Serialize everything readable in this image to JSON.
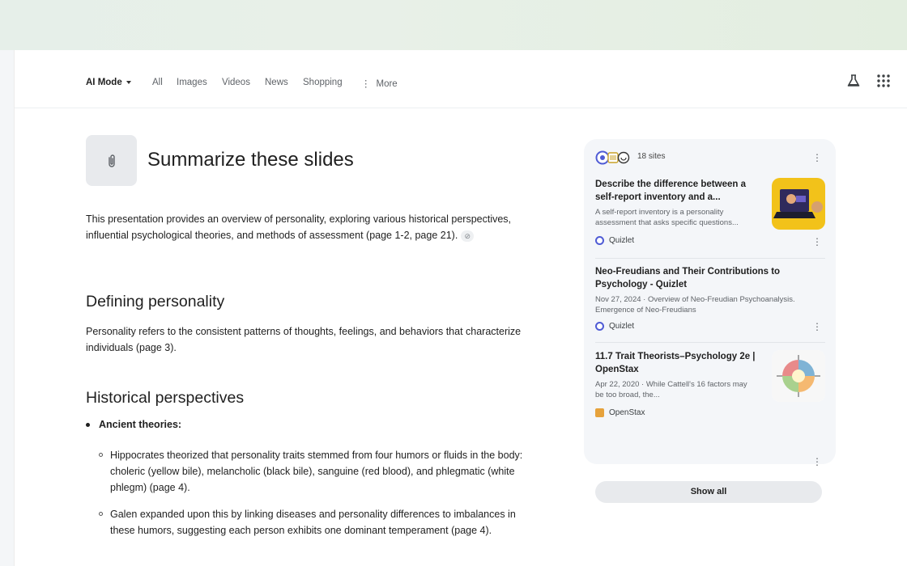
{
  "nav": {
    "ai_mode": "AI Mode",
    "tabs": [
      "All",
      "Images",
      "Videos",
      "News",
      "Shopping"
    ],
    "more": "More"
  },
  "query": {
    "title": "Summarize these slides",
    "attachment_icon": "paperclip-icon"
  },
  "answer": {
    "intro": "This presentation provides an overview of personality, exploring various historical perspectives, influential psychological theories, and methods of assessment (page 1-2, page 21).",
    "section1_heading": "Defining personality",
    "section1_text": "Personality refers to the consistent patterns of thoughts, feelings, and behaviors that characterize individuals (page 3).",
    "section2_heading": "Historical perspectives",
    "bullet_label": "Ancient theories:",
    "sub_bullets": [
      "Hippocrates theorized that personality traits stemmed from four humors or fluids in the body: choleric (yellow bile), melancholic (black bile), sanguine (red blood), and phlegmatic (white phlegm) (page 4).",
      "Galen expanded upon this by linking diseases and personality differences to imbalances in these humors, suggesting each person exhibits one dominant temperament (page 4)."
    ]
  },
  "sources": {
    "count_label": "18 sites",
    "items": [
      {
        "title": "Describe the difference between a self-report inventory and a...",
        "snippet": "A self-report inventory is a personality assessment that asks specific questions...",
        "site": "Quizlet",
        "favicon_color": "#4f5bd5"
      },
      {
        "title": "Neo-Freudians and Their Contributions to Psychology - Quizlet",
        "snippet": "Nov 27, 2024 · Overview of Neo-Freudian Psychoanalysis. Emergence of Neo-Freudians",
        "site": "Quizlet",
        "favicon_color": "#4f5bd5"
      },
      {
        "title": "11.7 Trait Theorists–Psychology 2e | OpenStax",
        "snippet": "Apr 22, 2020 · While Cattell's 16 factors may be too broad, the...",
        "site": "OpenStax",
        "favicon_color": "#e6a23c"
      }
    ],
    "show_all": "Show all"
  },
  "colors": {
    "accent": "#4f5bd5",
    "panel_bg": "#f4f6f9"
  }
}
